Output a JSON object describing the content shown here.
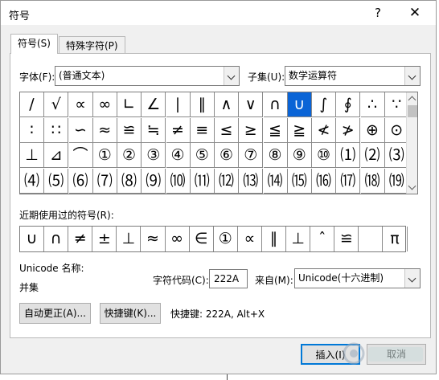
{
  "title": "符号",
  "title_buttons": {
    "help": "?",
    "close": "✕"
  },
  "tabs": [
    {
      "label": "符号(S)"
    },
    {
      "label": "特殊字符(P)"
    }
  ],
  "font": {
    "label": "字体(F):",
    "value": "(普通文本)"
  },
  "subset": {
    "label": "子集(U):",
    "value": "数学运算符"
  },
  "symbols": [
    [
      "∕",
      "√",
      "∝",
      "∞",
      "∟",
      "∠",
      "∣",
      "∥",
      "∧",
      "∨",
      "∩",
      "∪",
      "∫",
      "∮",
      "∴",
      "∵"
    ],
    [
      "∶",
      "∷",
      "∽",
      "≈",
      "≌",
      "≒",
      "≠",
      "≡",
      "≤",
      "≥",
      "≦",
      "≧",
      "≮",
      "≯",
      "⊕",
      "⊙"
    ],
    [
      "⊥",
      "⊿",
      "⌒",
      "①",
      "②",
      "③",
      "④",
      "⑤",
      "⑥",
      "⑦",
      "⑧",
      "⑨",
      "⑩",
      "⑴",
      "⑵",
      "⑶"
    ],
    [
      "⑷",
      "⑸",
      "⑹",
      "⑺",
      "⑻",
      "⑼",
      "⑽",
      "⑾",
      "⑿",
      "⒀",
      "⒁",
      "⒂",
      "⒃",
      "⒄",
      "⒅",
      "⒆"
    ]
  ],
  "selected_symbol": "∪",
  "recent": {
    "label": "近期使用过的符号(R):",
    "symbols": [
      "∪",
      "∩",
      "≠",
      "±",
      "⊥",
      "≈",
      "∞",
      "∈",
      "①",
      "∝",
      "∥",
      "⊥",
      "ˆ",
      "≌",
      "",
      "π"
    ]
  },
  "unicode_name": {
    "label": "Unicode 名称:",
    "value": "并集"
  },
  "char_code": {
    "label": "字符代码(C):",
    "value": "222A"
  },
  "from": {
    "label": "来自(M):",
    "value": "Unicode(十六进制)"
  },
  "buttons": {
    "autocorrect": "自动更正(A)...",
    "shortcut": "快捷键(K)...",
    "insert": "插入(I)",
    "cancel": "取消"
  },
  "shortcut_text": "快捷键: 222A, Alt+X"
}
